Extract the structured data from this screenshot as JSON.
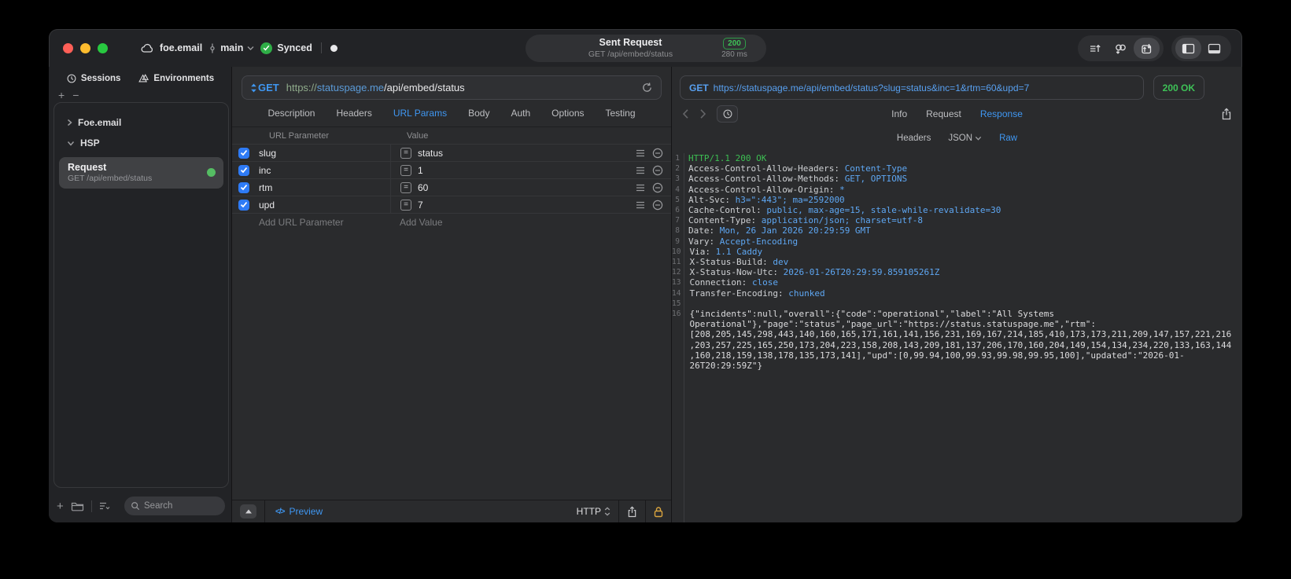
{
  "titlebar": {
    "project": "foe.email",
    "branch": "main",
    "sync_label": "Synced",
    "request_title": "Sent Request",
    "request_subtitle": "GET /api/embed/status",
    "status_code": "200",
    "duration": "280 ms"
  },
  "sidebar": {
    "tabs": [
      "Sessions",
      "Environments"
    ],
    "tree": [
      {
        "label": "Foe.email",
        "expanded": false
      },
      {
        "label": "HSP",
        "expanded": true
      }
    ],
    "request": {
      "title": "Request",
      "subtitle": "GET /api/embed/status"
    },
    "search_placeholder": "Search"
  },
  "request_panel": {
    "method": "GET",
    "url": {
      "scheme": "https://",
      "host": "statuspage.me",
      "path": "/api/embed/status"
    },
    "tabs": [
      "Description",
      "Headers",
      "URL Params",
      "Body",
      "Auth",
      "Options",
      "Testing"
    ],
    "active_tab": "URL Params",
    "params": {
      "col_name": "URL Parameter",
      "col_value": "Value",
      "rows": [
        {
          "name": "slug",
          "value": "status",
          "enabled": true
        },
        {
          "name": "inc",
          "value": "1",
          "enabled": true
        },
        {
          "name": "rtm",
          "value": "60",
          "enabled": true
        },
        {
          "name": "upd",
          "value": "7",
          "enabled": true
        }
      ],
      "add_name": "Add URL Parameter",
      "add_value": "Add Value"
    },
    "footer": {
      "preview": "Preview",
      "protocol": "HTTP"
    }
  },
  "response_panel": {
    "method": "GET",
    "url": "https://statuspage.me/api/embed/status?slug=status&inc=1&rtm=60&upd=7",
    "status": "200 OK",
    "tabs": [
      "Info",
      "Request",
      "Response"
    ],
    "active_tab": "Response",
    "subtabs": [
      "Headers",
      "JSON",
      "Raw"
    ],
    "active_subtab": "Raw",
    "raw": {
      "status_line": "HTTP/1.1 200 OK",
      "headers": [
        {
          "name": "Access-Control-Allow-Headers",
          "value": "Content-Type"
        },
        {
          "name": "Access-Control-Allow-Methods",
          "value": "GET, OPTIONS"
        },
        {
          "name": "Access-Control-Allow-Origin",
          "value": "*"
        },
        {
          "name": "Alt-Svc",
          "value": "h3=\":443\"; ma=2592000"
        },
        {
          "name": "Cache-Control",
          "value": "public, max-age=15, stale-while-revalidate=30"
        },
        {
          "name": "Content-Type",
          "value": "application/json; charset=utf-8"
        },
        {
          "name": "Date",
          "value": "Mon, 26 Jan 2026 20:29:59 GMT"
        },
        {
          "name": "Vary",
          "value": "Accept-Encoding"
        },
        {
          "name": "Via",
          "value": "1.1 Caddy"
        },
        {
          "name": "X-Status-Build",
          "value": "dev"
        },
        {
          "name": "X-Status-Now-Utc",
          "value": "2026-01-26T20:29:59.859105261Z"
        },
        {
          "name": "Connection",
          "value": "close"
        },
        {
          "name": "Transfer-Encoding",
          "value": "chunked"
        }
      ],
      "body": "{\"incidents\":null,\"overall\":{\"code\":\"operational\",\"label\":\"All Systems Operational\"},\"page\":\"status\",\"page_url\":\"https://status.statuspage.me\",\"rtm\":[208,205,145,298,443,140,160,165,171,161,141,156,231,169,167,214,185,410,173,173,211,209,147,157,221,216,203,257,225,165,250,173,204,223,158,208,143,209,181,137,206,170,160,204,149,154,134,234,220,133,163,144,160,218,159,138,178,135,173,141],\"upd\":[0,99.94,100,99.93,99.98,99.95,100],\"updated\":\"2026-01-26T20:29:59Z\"}"
    }
  },
  "glyphs": {
    "plus": "+",
    "minus": "−",
    "equals": "=",
    "code": "</>"
  }
}
